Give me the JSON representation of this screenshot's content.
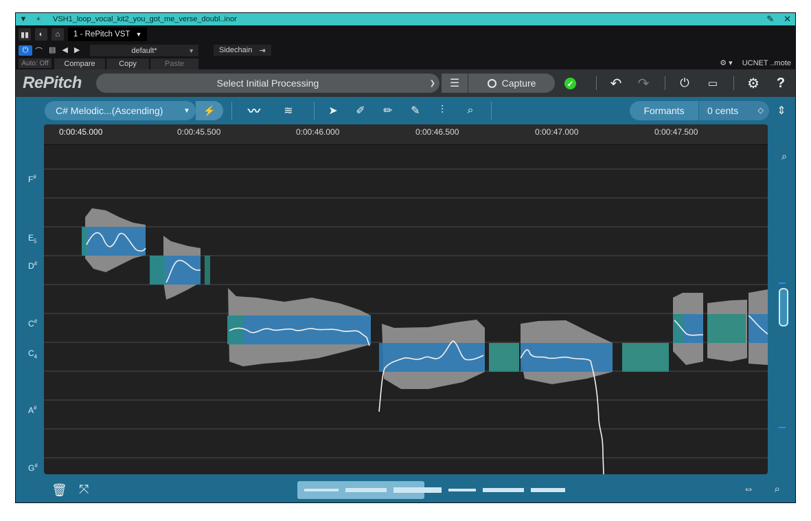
{
  "window": {
    "title": "VSH1_loop_vocal_kit2_you_got_me_verse_doubl..inor",
    "pin_icon": "pin-icon",
    "close_icon": "close-icon"
  },
  "host": {
    "instance": "1 - RePitch VST",
    "preset": "default*",
    "compare": "Compare",
    "copy": "Copy",
    "paste": "Paste",
    "auto_off": "Auto: Off",
    "sidechain": "Sidechain",
    "remote": "UCNET ..mote"
  },
  "repitch": {
    "logo": "RePitch",
    "processing": "Select Initial Processing",
    "capture": "Capture",
    "scale": "C# Melodic...(Ascending)",
    "formants": "Formants",
    "cents": "0 cents"
  },
  "ruler": {
    "ticks": [
      "0:00:45.000",
      "0:00:45.500",
      "0:00:46.000",
      "0:00:46.500",
      "0:00:47.000",
      "0:00:47.500"
    ]
  },
  "notes": [
    {
      "name": "F",
      "accidental": "#",
      "octave": ""
    },
    {
      "name": "E",
      "accidental": "",
      "octave": "5"
    },
    {
      "name": "D",
      "accidental": "#",
      "octave": ""
    },
    {
      "name": "C",
      "accidental": "#",
      "octave": ""
    },
    {
      "name": "C",
      "accidental": "",
      "octave": "4"
    },
    {
      "name": "A",
      "accidental": "#",
      "octave": ""
    },
    {
      "name": "G",
      "accidental": "#",
      "octave": ""
    }
  ],
  "colors": {
    "titlebar": "#3cc6c6",
    "plugin_bg": "#1f6b8e",
    "note_blue": "#2f7bb5",
    "note_teal": "#2a8c82",
    "waveform": "#8c8c8c",
    "pitch_curve": "#ffffff",
    "ok_green": "#2ed12a"
  }
}
